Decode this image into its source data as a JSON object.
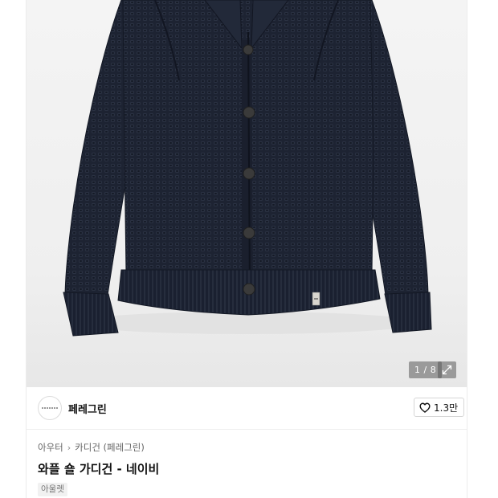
{
  "gallery": {
    "counter_current": "1",
    "counter_separator": " / ",
    "counter_total": "8",
    "expand_icon": "expand-icon"
  },
  "brand": {
    "name": "페레그린",
    "logo_icon": "brand-logo"
  },
  "like": {
    "icon": "heart-icon",
    "count": "1.3만"
  },
  "breadcrumb": {
    "items": [
      "아우터",
      "카디건 (페레그린)"
    ],
    "separator_icon": "chevron-right-icon"
  },
  "product": {
    "title": "와플 숄 가디건 - 네이비",
    "tag": "아울렛"
  },
  "colors": {
    "cardigan": "#1c2331",
    "background": "#f2f2f2",
    "overlay": "#5a5a5a"
  }
}
